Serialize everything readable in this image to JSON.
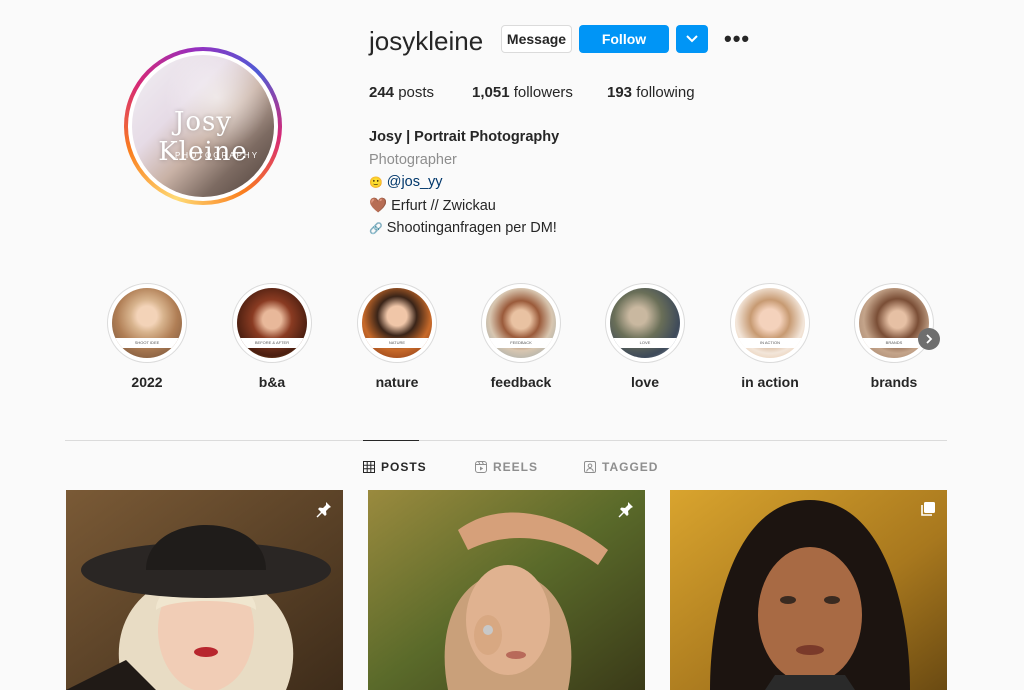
{
  "profile": {
    "username": "josykleine",
    "avatar_brand": "Josy Kleine",
    "avatar_sub": "PHOTOGRAPHY"
  },
  "buttons": {
    "message": "Message",
    "follow": "Follow",
    "more": "•••"
  },
  "stats": {
    "posts_count": "244",
    "posts_label": "posts",
    "followers_count": "1,051",
    "followers_label": "followers",
    "following_count": "193",
    "following_label": "following"
  },
  "bio": {
    "name": "Josy | Portrait Photography",
    "category": "Photographer",
    "line1_emoji": "🙂",
    "line1_link": "@jos_yy",
    "line2_emoji": "🤎",
    "line2_text": "Erfurt // Zwickau",
    "line3_emoji": "🔗",
    "line3_text": "Shootinganfragen per DM!"
  },
  "highlights": [
    {
      "label": "2022",
      "band": "SHOOT IDEE"
    },
    {
      "label": "b&a",
      "band": "BEFORE & AFTER"
    },
    {
      "label": "nature",
      "band": "NATURE"
    },
    {
      "label": "feedback",
      "band": "FEEDBACK"
    },
    {
      "label": "love",
      "band": "LOVE"
    },
    {
      "label": "in action",
      "band": "IN ACTION"
    },
    {
      "label": "brands",
      "band": "BRANDS"
    }
  ],
  "tabs": [
    {
      "label": "POSTS",
      "icon": "grid-icon"
    },
    {
      "label": "REELS",
      "icon": "reels-icon"
    },
    {
      "label": "TAGGED",
      "icon": "tagged-icon"
    }
  ],
  "posts": [
    {
      "icon": "pin-icon"
    },
    {
      "icon": "pin-icon"
    },
    {
      "icon": "carousel-icon"
    }
  ],
  "colors": {
    "accent": "#0095f6",
    "text": "#262626",
    "muted": "#8e8e8e",
    "link": "#00376b",
    "background": "#fafafa"
  }
}
